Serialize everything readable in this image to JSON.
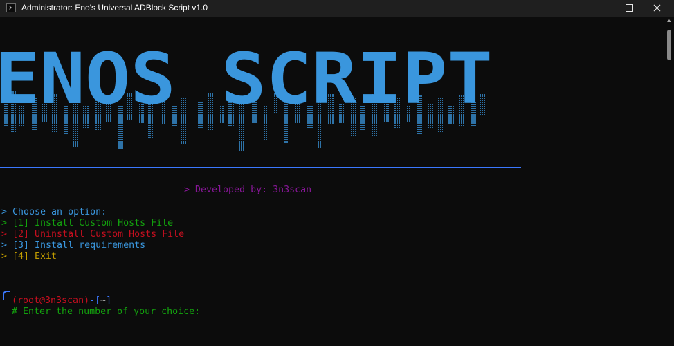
{
  "window": {
    "title": "Administrator:  Eno's Universal ADBlock Script v1.0",
    "icon": "terminal-icon",
    "controls": [
      "minimize-icon",
      "maximize-icon",
      "close-icon"
    ]
  },
  "banner": {
    "text": "ENOS SCRIPT",
    "color": "#3a96dd",
    "rule_color": "#3b78ff"
  },
  "developer_line": "> Developed by: 3n3scan",
  "menu": {
    "heading": "> Choose an option:",
    "options": [
      {
        "text": "> [1] Install Custom Hosts File",
        "color": "#13a10e"
      },
      {
        "text": "> [2] Uninstall Custom Hosts File",
        "color": "#c50f1f"
      },
      {
        "text": "> [3] Install requirements",
        "color": "#3a96dd"
      },
      {
        "text": "> [4] Exit",
        "color": "#c19c00"
      }
    ]
  },
  "prompt": {
    "user": "(root@3n3scan)",
    "sep": "-[",
    "dir": "~",
    "close": "]",
    "question": "# Enter the number of your choice:"
  },
  "colors": {
    "background": "#0c0c0c",
    "titlebar": "#1f1f1f",
    "blue": "#3b78ff",
    "green": "#13a10e",
    "red": "#c50f1f",
    "yellow": "#c19c00",
    "purple": "#881798"
  }
}
